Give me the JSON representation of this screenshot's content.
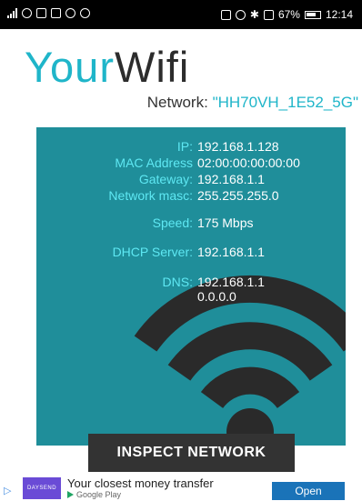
{
  "status_bar": {
    "battery": "67%",
    "time": "12:14"
  },
  "app": {
    "title_part1": "Your",
    "title_part2": "Wifi"
  },
  "network": {
    "label": "Network:",
    "name": "\"HH70VH_1E52_5G\""
  },
  "info": {
    "ip_label": "IP:",
    "ip": "192.168.1.128",
    "mac_label": "MAC Address",
    "mac": "02:00:00:00:00:00",
    "gateway_label": "Gateway:",
    "gateway": "192.168.1.1",
    "mask_label": "Network masc:",
    "mask": "255.255.255.0",
    "speed_label": "Speed:",
    "speed": "175 Mbps",
    "dhcp_label": "DHCP Server:",
    "dhcp": "192.168.1.1",
    "dns_label": "DNS:",
    "dns1": "192.168.1.1",
    "dns2": "0.0.0.0"
  },
  "actions": {
    "inspect_label": "INSPECT NETWORK"
  },
  "ad": {
    "brand": "DAYSEND",
    "title": "Your closest money transfer",
    "store": "Google Play",
    "button": "Open"
  },
  "colors": {
    "accent": "#1fb5c9",
    "card": "#1f8e9a",
    "label": "#5ee8f3",
    "button": "#333333"
  }
}
